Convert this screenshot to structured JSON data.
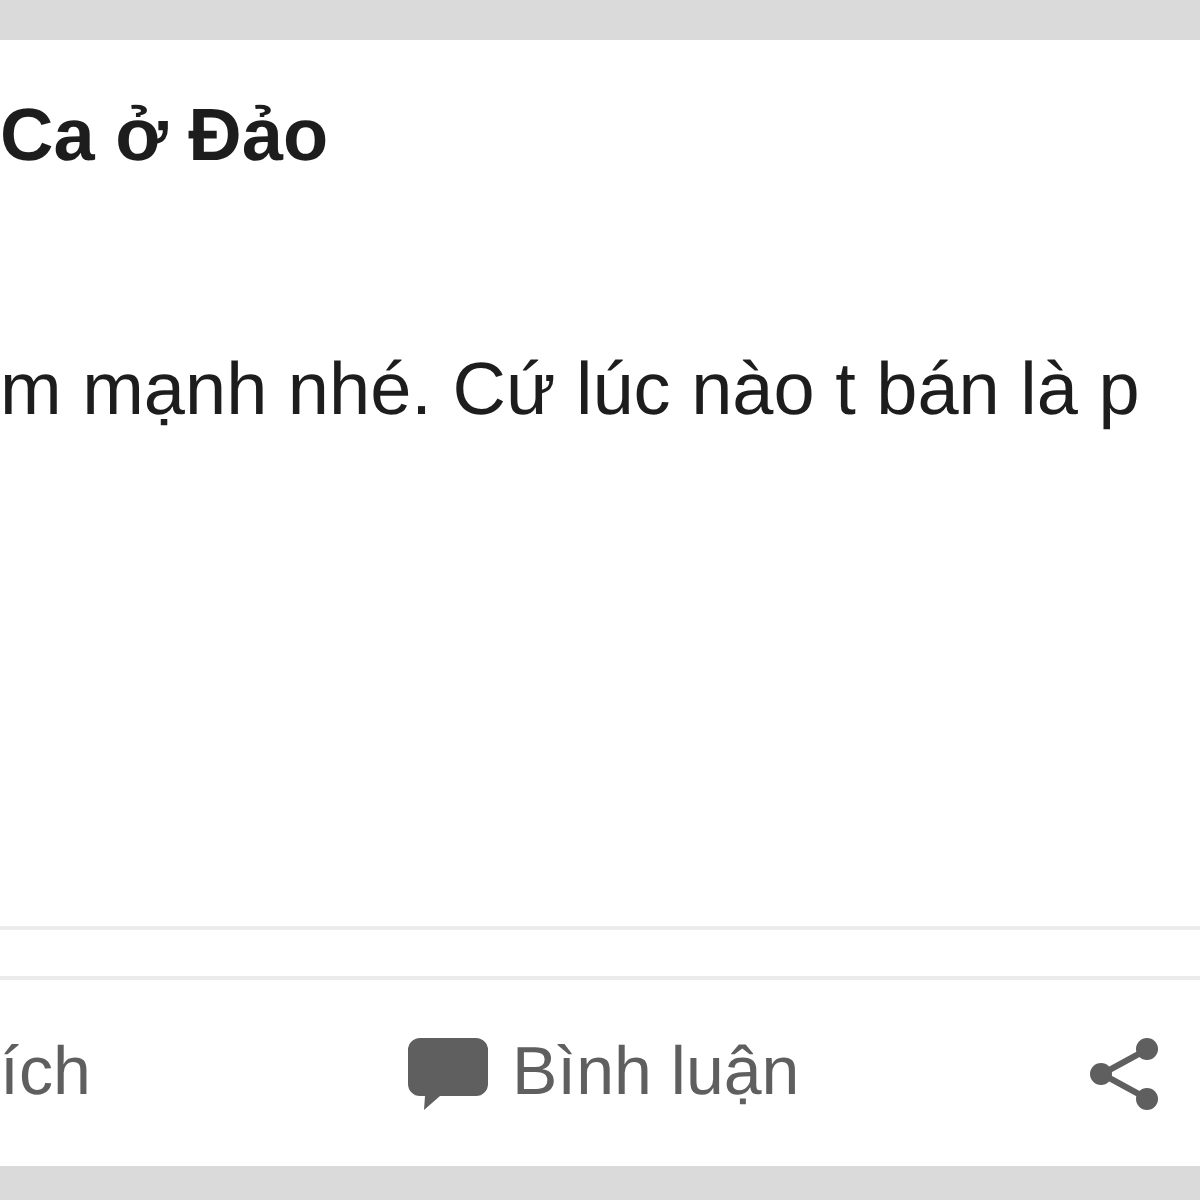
{
  "post": {
    "author": "Ca ở Đảo",
    "text": "m mạnh nhé. Cứ lúc nào t bán là p"
  },
  "actions": [
    {
      "kind": "like",
      "label": "ích"
    },
    {
      "kind": "comment",
      "label": "Bình luận"
    },
    {
      "kind": "share"
    }
  ]
}
